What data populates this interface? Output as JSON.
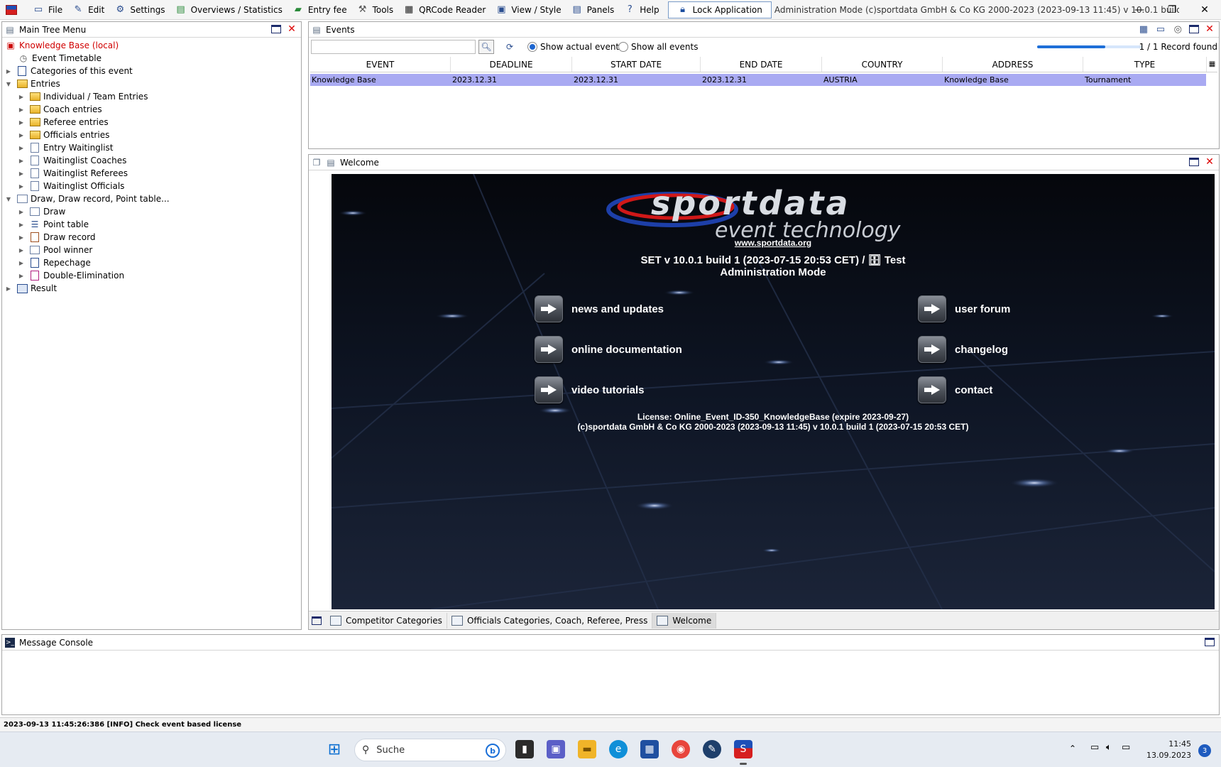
{
  "menubar": {
    "items": [
      {
        "label": "File",
        "icon": "folder-icon"
      },
      {
        "label": "Edit",
        "icon": "edit-icon"
      },
      {
        "label": "Settings",
        "icon": "gear-icon"
      },
      {
        "label": "Overviews / Statistics",
        "icon": "chart-icon"
      },
      {
        "label": "Entry fee",
        "icon": "money-icon"
      },
      {
        "label": "Tools",
        "icon": "wrench-icon"
      },
      {
        "label": "QRCode Reader",
        "icon": "qrcode-icon"
      },
      {
        "label": "View / Style",
        "icon": "view-icon"
      },
      {
        "label": "Panels",
        "icon": "panels-icon"
      },
      {
        "label": "Help",
        "icon": "help-icon"
      }
    ],
    "lock_label": "Lock Application",
    "window_title": "Administration Mode (c)sportdata GmbH & Co KG 2000-2023 (2023-09-13 11:45)  v 10.0.1 build 1 (2023-07..."
  },
  "tree": {
    "title": "Main Tree Menu",
    "items": [
      {
        "label": "Knowledge Base (local)"
      },
      {
        "label": "Event Timetable"
      },
      {
        "label": "Categories of this event"
      },
      {
        "label": "Entries"
      },
      {
        "label": "Individual / Team Entries"
      },
      {
        "label": "Coach entries"
      },
      {
        "label": "Referee entries"
      },
      {
        "label": "Officials entries"
      },
      {
        "label": "Entry Waitinglist"
      },
      {
        "label": "Waitinglist Coaches"
      },
      {
        "label": "Waitinglist Referees"
      },
      {
        "label": "Waitinglist Officials"
      },
      {
        "label": "Draw, Draw record, Point table..."
      },
      {
        "label": "Draw"
      },
      {
        "label": "Point table"
      },
      {
        "label": "Draw record"
      },
      {
        "label": "Pool winner"
      },
      {
        "label": "Repechage"
      },
      {
        "label": "Double-Elimination"
      },
      {
        "label": "Result"
      }
    ]
  },
  "events": {
    "title": "Events",
    "search_value": "",
    "radio_actual": "Show actual events",
    "radio_all": "Show all events",
    "progress": 0.65,
    "record_count": "1 / 1 Record found",
    "columns": [
      "EVENT",
      "DEADLINE",
      "START DATE",
      "END DATE",
      "COUNTRY",
      "ADDRESS",
      "TYPE"
    ],
    "rows": [
      [
        "Knowledge Base",
        "2023.12.31",
        "2023.12.31",
        "2023.12.31",
        "AUSTRIA",
        "Knowledge Base",
        "Tournament"
      ]
    ]
  },
  "welcome": {
    "title": "Welcome",
    "logo_main": "sportdata",
    "logo_sub": "event technology",
    "url": "www.sportdata.org",
    "version": "SET v 10.0.1 build 1 (2023-07-15 20:53 CET) /",
    "db_name": "Test",
    "mode": "Administration Mode",
    "links": {
      "news": "news and updates",
      "docs": "online documentation",
      "videos": "video tutorials",
      "forum": "user forum",
      "changelog": "changelog",
      "contact": "contact"
    },
    "license_line1": "License: Online_Event_ID-350_KnowledgeBase (expire 2023-09-27)",
    "license_line2": "(c)sportdata GmbH & Co KG 2000-2023 (2023-09-13 11:45) v 10.0.1 build 1 (2023-07-15 20:53 CET)",
    "tabs": [
      "Competitor Categories",
      "Officials Categories, Coach, Referee, Press",
      "Welcome"
    ]
  },
  "console": {
    "title": "Message Console"
  },
  "status": {
    "message": "2023-09-13 11:45:26:386 [INFO] Check event based license"
  },
  "taskbar": {
    "search_placeholder": "Suche",
    "time": "11:45",
    "date": "13.09.2023",
    "notifications": "3"
  },
  "colors": {
    "selection": "#a9aaf2",
    "accent": "#1e66d0",
    "close": "#dd0000"
  }
}
